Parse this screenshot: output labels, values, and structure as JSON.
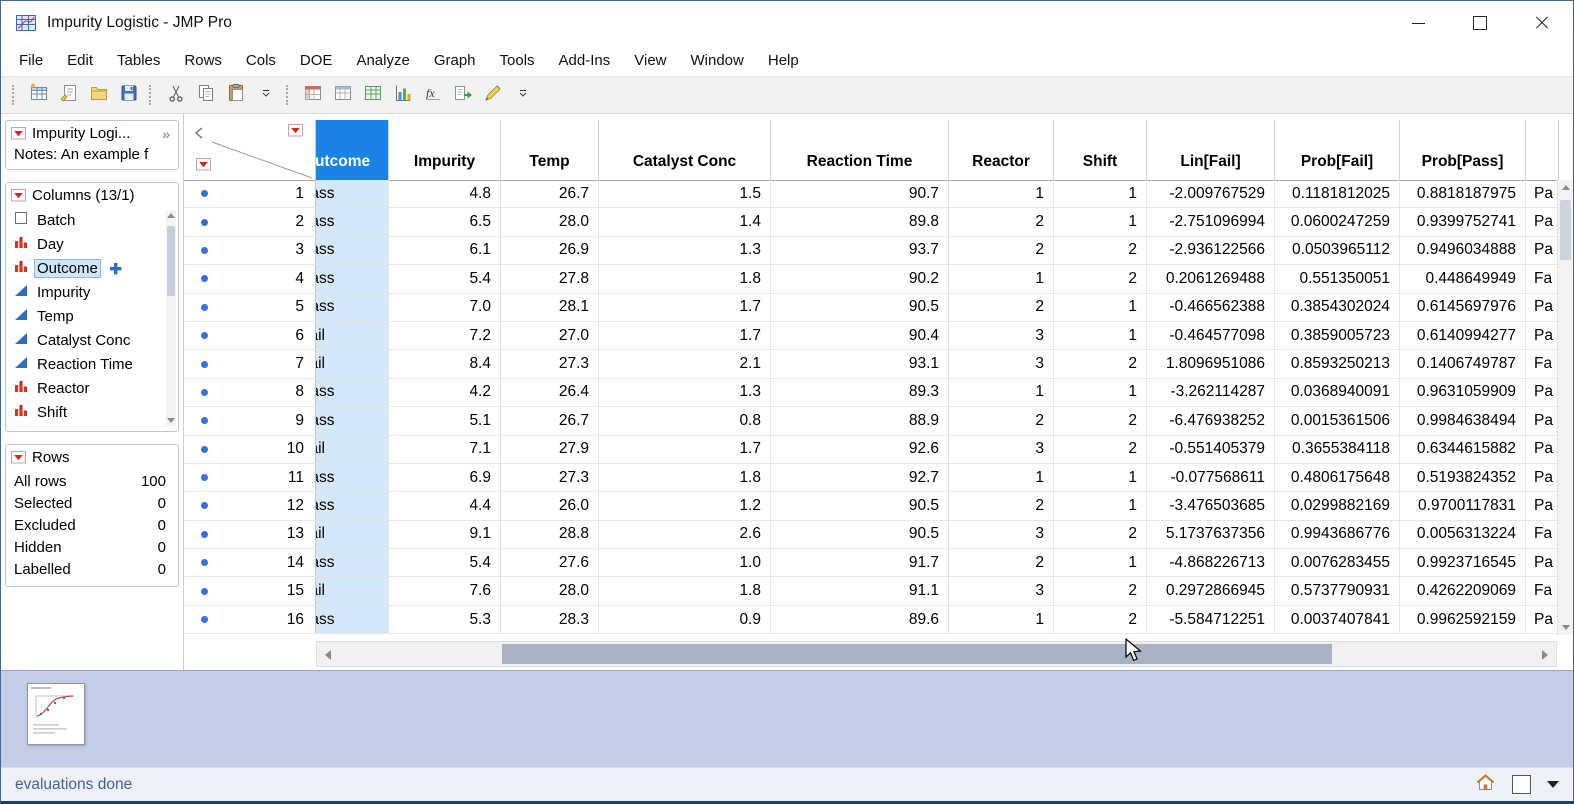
{
  "window": {
    "title": "Impurity Logistic - JMP Pro",
    "controls": [
      "minimize",
      "maximize",
      "close"
    ]
  },
  "menu": {
    "items": [
      "File",
      "Edit",
      "Tables",
      "Rows",
      "Cols",
      "DOE",
      "Analyze",
      "Graph",
      "Tools",
      "Add-Ins",
      "View",
      "Window",
      "Help"
    ]
  },
  "toolbar": {
    "icons": [
      "new-data-table",
      "journal",
      "open",
      "save",
      "cut",
      "copy",
      "paste",
      "toolbar-overflow",
      "data-table",
      "summary-table",
      "tabulate",
      "graph-builder",
      "formula",
      "run-script",
      "annotate",
      "platform-overflow"
    ]
  },
  "sidebar": {
    "table_panel": {
      "title": "Impurity Logi...",
      "notes_label": "Notes:  An example f"
    },
    "columns_panel": {
      "title": "Columns (13/1)",
      "items": [
        {
          "label": "Batch",
          "icon": "checkbox",
          "selected": false
        },
        {
          "label": "Day",
          "icon": "nominal-bars",
          "selected": false
        },
        {
          "label": "Outcome",
          "icon": "nominal-bars",
          "selected": true
        },
        {
          "label": "Impurity",
          "icon": "continuous",
          "selected": false
        },
        {
          "label": "Temp",
          "icon": "continuous",
          "selected": false
        },
        {
          "label": "Catalyst Conc",
          "icon": "continuous",
          "selected": false
        },
        {
          "label": "Reaction Time",
          "icon": "continuous",
          "selected": false
        },
        {
          "label": "Reactor",
          "icon": "nominal-bars",
          "selected": false
        },
        {
          "label": "Shift",
          "icon": "nominal-bars",
          "selected": false
        }
      ]
    },
    "rows_panel": {
      "title": "Rows",
      "stats": [
        {
          "label": "All rows",
          "value": "100"
        },
        {
          "label": "Selected",
          "value": "0"
        },
        {
          "label": "Excluded",
          "value": "0"
        },
        {
          "label": "Hidden",
          "value": "0"
        },
        {
          "label": "Labelled",
          "value": "0"
        }
      ]
    }
  },
  "table": {
    "columns": [
      "Outcome",
      "Impurity",
      "Temp",
      "Catalyst Conc",
      "Reaction Time",
      "Reactor",
      "Shift",
      "Lin[Fail]",
      "Prob[Fail]",
      "Prob[Pass]"
    ],
    "rows": [
      {
        "n": "1",
        "values": [
          "Pass",
          "4.8",
          "26.7",
          "1.5",
          "90.7",
          "1",
          "1",
          "-2.009767529",
          "0.1181812025",
          "0.8818187975",
          "Pa"
        ]
      },
      {
        "n": "2",
        "values": [
          "Pass",
          "6.5",
          "28.0",
          "1.4",
          "89.8",
          "2",
          "1",
          "-2.751096994",
          "0.0600247259",
          "0.9399752741",
          "Pa"
        ]
      },
      {
        "n": "3",
        "values": [
          "Pass",
          "6.1",
          "26.9",
          "1.3",
          "93.7",
          "2",
          "2",
          "-2.936122566",
          "0.0503965112",
          "0.9496034888",
          "Pa"
        ]
      },
      {
        "n": "4",
        "values": [
          "Pass",
          "5.4",
          "27.8",
          "1.8",
          "90.2",
          "1",
          "2",
          "0.2061269488",
          "0.551350051",
          "0.448649949",
          "Fa"
        ]
      },
      {
        "n": "5",
        "values": [
          "Pass",
          "7.0",
          "28.1",
          "1.7",
          "90.5",
          "2",
          "1",
          "-0.466562388",
          "0.3854302024",
          "0.6145697976",
          "Pa"
        ]
      },
      {
        "n": "6",
        "values": [
          "Fail",
          "7.2",
          "27.0",
          "1.7",
          "90.4",
          "3",
          "1",
          "-0.464577098",
          "0.3859005723",
          "0.6140994277",
          "Pa"
        ]
      },
      {
        "n": "7",
        "values": [
          "Fail",
          "8.4",
          "27.3",
          "2.1",
          "93.1",
          "3",
          "2",
          "1.8096951086",
          "0.8593250213",
          "0.1406749787",
          "Fa"
        ]
      },
      {
        "n": "8",
        "values": [
          "Pass",
          "4.2",
          "26.4",
          "1.3",
          "89.3",
          "1",
          "1",
          "-3.262114287",
          "0.0368940091",
          "0.9631059909",
          "Pa"
        ]
      },
      {
        "n": "9",
        "values": [
          "Pass",
          "5.1",
          "26.7",
          "0.8",
          "88.9",
          "2",
          "2",
          "-6.476938252",
          "0.0015361506",
          "0.9984638494",
          "Pa"
        ]
      },
      {
        "n": "10",
        "values": [
          "Fail",
          "7.1",
          "27.9",
          "1.7",
          "92.6",
          "3",
          "2",
          "-0.551405379",
          "0.3655384118",
          "0.6344615882",
          "Pa"
        ]
      },
      {
        "n": "11",
        "values": [
          "Pass",
          "6.9",
          "27.3",
          "1.8",
          "92.7",
          "1",
          "1",
          "-0.077568611",
          "0.4806175648",
          "0.5193824352",
          "Pa"
        ]
      },
      {
        "n": "12",
        "values": [
          "Pass",
          "4.4",
          "26.0",
          "1.2",
          "90.5",
          "2",
          "1",
          "-3.476503685",
          "0.0299882169",
          "0.9700117831",
          "Pa"
        ]
      },
      {
        "n": "13",
        "values": [
          "Fail",
          "9.1",
          "28.8",
          "2.6",
          "90.5",
          "3",
          "2",
          "5.1737637356",
          "0.9943686776",
          "0.0056313224",
          "Fa"
        ]
      },
      {
        "n": "14",
        "values": [
          "Pass",
          "5.4",
          "27.6",
          "1.0",
          "91.7",
          "2",
          "1",
          "-4.868226713",
          "0.0076283455",
          "0.9923716545",
          "Pa"
        ]
      },
      {
        "n": "15",
        "values": [
          "Fail",
          "7.6",
          "28.0",
          "1.8",
          "91.1",
          "3",
          "2",
          "0.2972866945",
          "0.5737790931",
          "0.4262209069",
          "Fa"
        ]
      },
      {
        "n": "16",
        "values": [
          "Pass",
          "5.3",
          "28.3",
          "0.9",
          "89.6",
          "1",
          "2",
          "-5.584712251",
          "0.0037407841",
          "0.9962592159",
          "Pa"
        ]
      }
    ]
  },
  "colors": {
    "selected_column_header": "#1b83e6",
    "selected_column_body": "#d5e8fa",
    "row_marker_blue": "#3a6fd8",
    "nominal_red": "#c03a30",
    "continuous_blue": "#2f6cc0"
  },
  "statusbar": {
    "text": "evaluations done",
    "icons": [
      "home",
      "restore-box",
      "dropdown"
    ]
  }
}
